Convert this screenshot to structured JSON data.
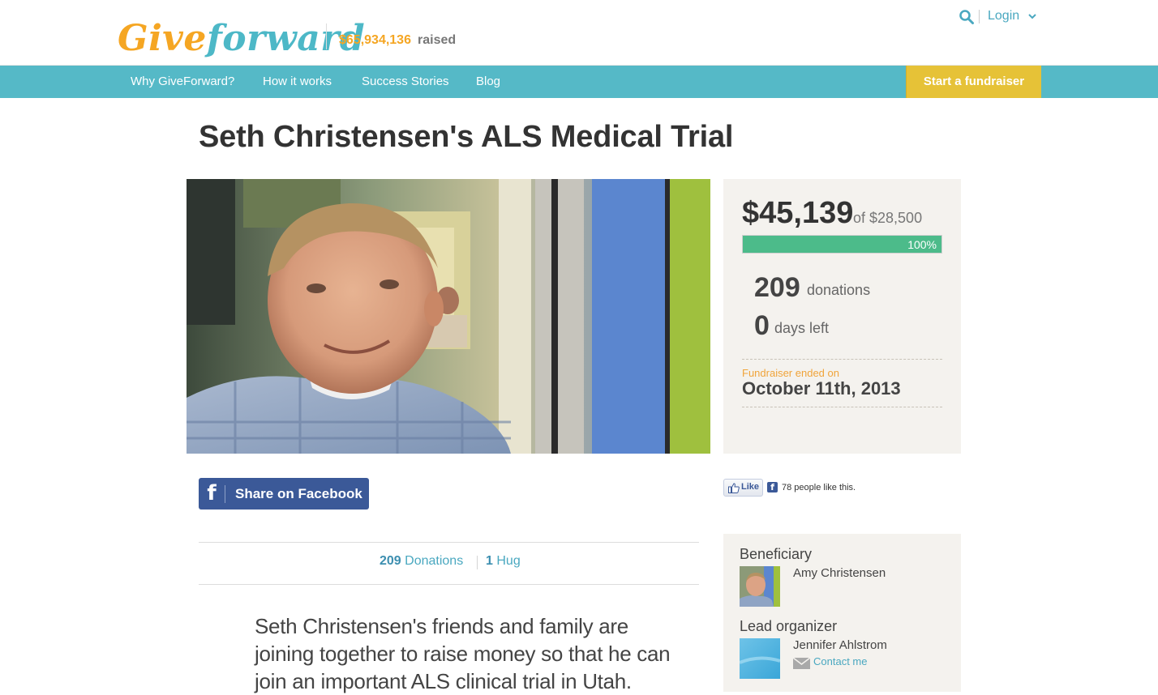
{
  "header": {
    "logo_give": "Give",
    "logo_forward": "forward",
    "total_raised_amount": "$65,934,136",
    "total_raised_label": "raised",
    "login_label": "Login"
  },
  "nav": {
    "items": [
      {
        "label": "Why GiveForward?"
      },
      {
        "label": "How it works"
      },
      {
        "label": "Success Stories"
      },
      {
        "label": "Blog"
      }
    ],
    "start_label": "Start a fundraiser"
  },
  "fundraiser": {
    "title": "Seth Christensen's ALS Medical Trial",
    "raised": "$45,139",
    "goal_text": "of $28,500",
    "progress_percent": 100,
    "progress_label": "100%",
    "donations_count": "209",
    "donations_label": "donations",
    "days_left_count": "0",
    "days_left_label": "days left",
    "ended_label": "Fundraiser ended on",
    "ended_date": "October 11th, 2013"
  },
  "share": {
    "facebook_label": "Share on Facebook",
    "like_label": "Like",
    "like_count_text": "78 people like this."
  },
  "tabs": {
    "donations_count": "209",
    "donations_label": "Donations",
    "hugs_count": "1",
    "hugs_label": "Hug"
  },
  "description": "Seth Christensen's friends and family are joining together to raise money so that he can join an important ALS clinical trial in Utah.",
  "people": {
    "beneficiary_title": "Beneficiary",
    "beneficiary_name": "Amy Christensen",
    "organizer_title": "Lead organizer",
    "organizer_name": "Jennifer Ahlstrom",
    "contact_label": "Contact me"
  },
  "colors": {
    "brand_orange": "#f5a623",
    "brand_teal": "#55b9c7",
    "start_yellow": "#e6c237",
    "progress_green": "#4cbb8a",
    "facebook_blue": "#3b5998"
  }
}
